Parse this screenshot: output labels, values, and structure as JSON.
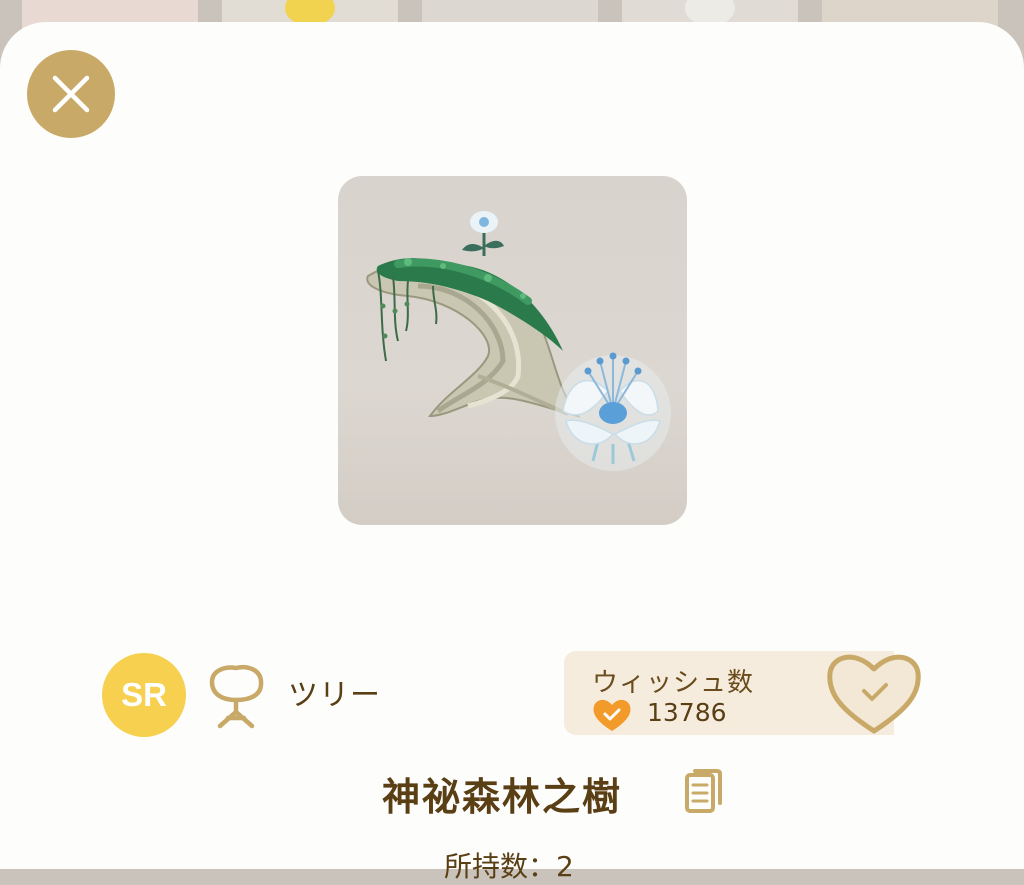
{
  "item": {
    "rarity": "SR",
    "category": "ツリー",
    "name": "神祕森林之樹",
    "owned": "所持数：2"
  },
  "wish": {
    "title": "ウィッシュ数",
    "count": "13786"
  },
  "icons": {
    "close": "close-icon",
    "category": "tree-category-icon",
    "wish_small": "heart-check-icon",
    "wish_button": "heart-outline-check-icon",
    "copy": "copy-icon"
  },
  "colors": {
    "accent_gold": "#c9a967",
    "text_brown": "#5a3f15",
    "rarity_yellow": "#f7d04f",
    "wish_orange": "#f29b2b",
    "wish_panel_bg": "#f6ecde"
  }
}
